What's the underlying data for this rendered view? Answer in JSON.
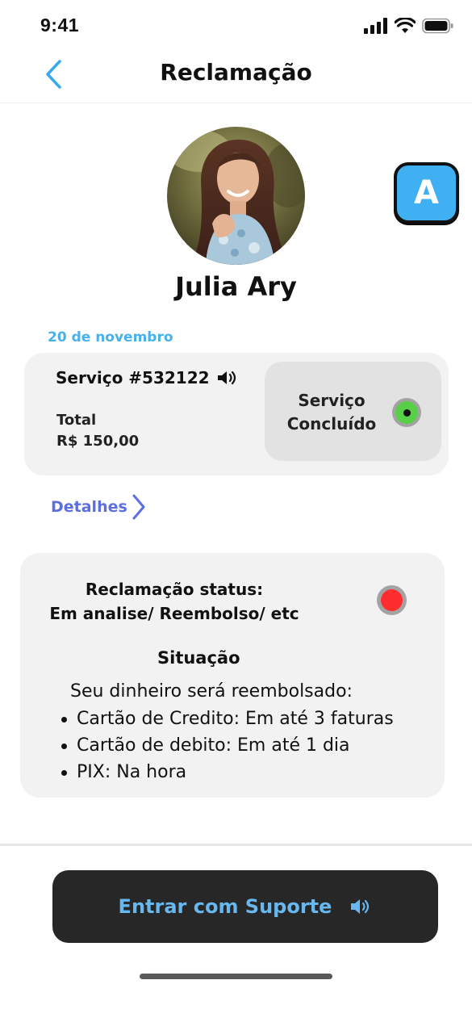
{
  "status_bar": {
    "time": "9:41"
  },
  "nav": {
    "title": "Reclamação"
  },
  "profile": {
    "name": "Julia Ary",
    "badge_letter": "A"
  },
  "service": {
    "date": "20 de novembro",
    "title": "Serviço #532122",
    "total_label": "Total",
    "total_value": "R$ 150,00",
    "status_line1": "Serviço",
    "status_line2": "Concluído",
    "status_color": "#57cf46"
  },
  "details_link": {
    "label": "Detalhes"
  },
  "complaint": {
    "status_line1": "Reclamação status:",
    "status_line2": "Em analise/ Reembolso/ etc",
    "status_color": "#ff2e2e",
    "situacao_title": "Situação",
    "situacao_intro": "Seu dinheiro será reembolsado:",
    "items": [
      "Cartão de Credito: Em até 3 faturas",
      "Cartão de debito: Em até 1 dia",
      "PIX: Na hora"
    ]
  },
  "support_button": {
    "label": "Entrar com  Suporte"
  },
  "colors": {
    "accent_blue": "#4ab0e8",
    "link_blue": "#5b6fe0",
    "button_dark": "#272727"
  },
  "icons": [
    "back-chevron-icon",
    "signal-icon",
    "wifi-icon",
    "battery-icon",
    "speaker-icon",
    "chevron-right-icon"
  ]
}
